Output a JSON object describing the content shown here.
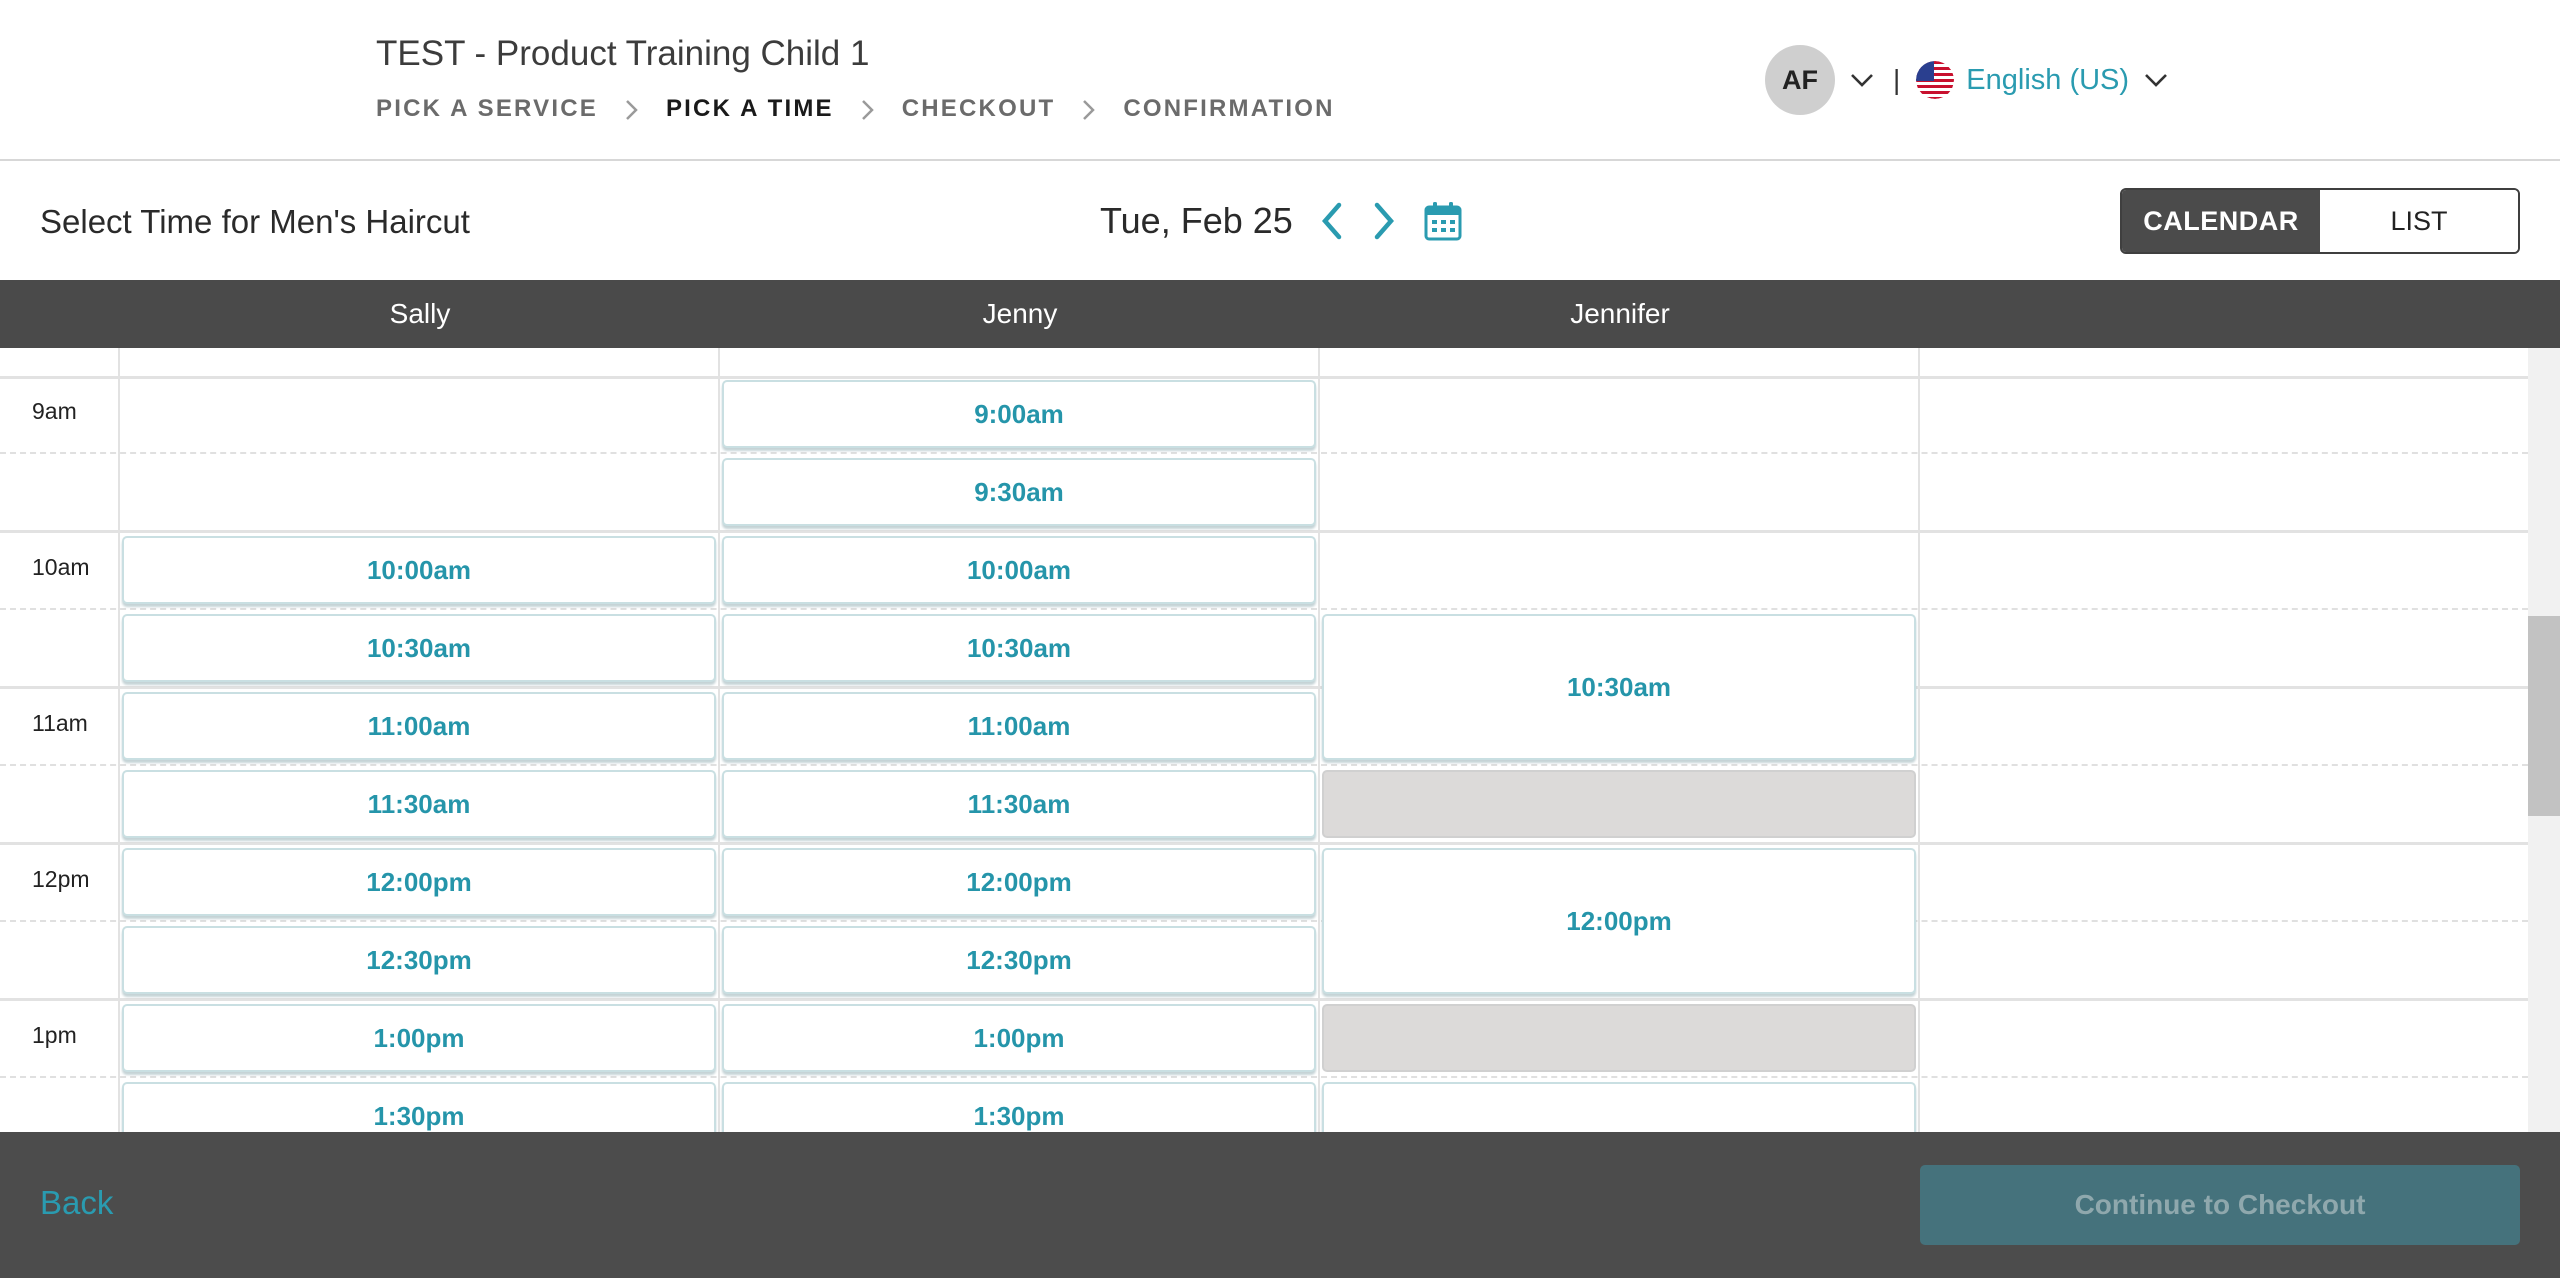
{
  "header": {
    "business_title": "TEST - Product Training Child 1",
    "steps": [
      {
        "label": "PICK A SERVICE",
        "active": false
      },
      {
        "label": "PICK A TIME",
        "active": true
      },
      {
        "label": "CHECKOUT",
        "active": false
      },
      {
        "label": "CONFIRMATION",
        "active": false
      }
    ],
    "user_initials": "AF",
    "language": "English (US)",
    "separator": "|"
  },
  "subheader": {
    "title": "Select Time for Men's Haircut",
    "date": "Tue, Feb 25",
    "view_calendar": "CALENDAR",
    "view_list": "LIST",
    "active_view": "CALENDAR"
  },
  "staff": [
    "Sally",
    "Jenny",
    "Jennifer"
  ],
  "hours": [
    "9am",
    "10am",
    "11am",
    "12pm",
    "1pm"
  ],
  "slots": {
    "sally": [
      "10:00am",
      "10:30am",
      "11:00am",
      "11:30am",
      "12:00pm",
      "12:30pm",
      "1:00pm",
      "1:30pm"
    ],
    "jenny": [
      "9:00am",
      "9:30am",
      "10:00am",
      "10:30am",
      "11:00am",
      "11:30am",
      "12:00pm",
      "12:30pm",
      "1:00pm",
      "1:30pm"
    ],
    "jennifer": [
      "10:30am",
      "12:00pm"
    ]
  },
  "footer": {
    "back_label": "Back",
    "continue_label": "Continue to Checkout"
  },
  "colors": {
    "accent": "#2595aa",
    "header_dark": "#4a4a4a",
    "continue_disabled": "#45727c",
    "blocked": "#dcdad9"
  }
}
